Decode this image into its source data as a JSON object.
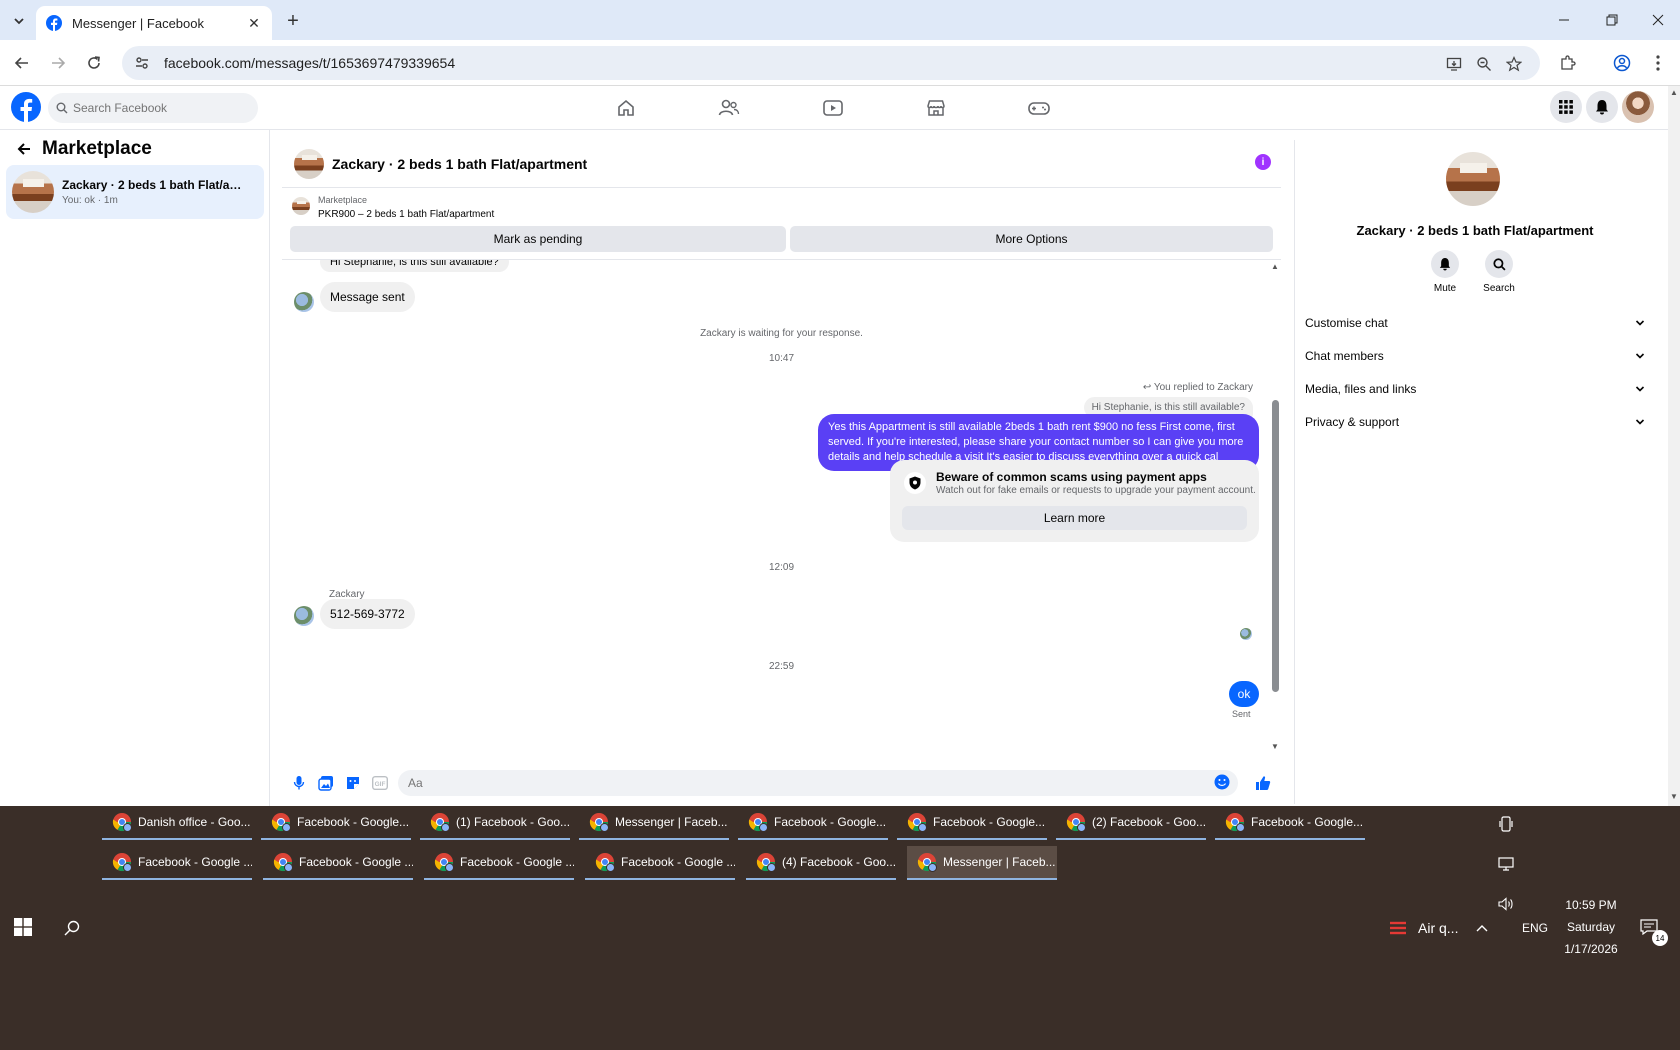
{
  "browser": {
    "tab_title": "Messenger | Facebook",
    "url": "facebook.com/messages/t/1653697479339654"
  },
  "facebook": {
    "search_placeholder": "Search Facebook"
  },
  "left": {
    "heading": "Marketplace",
    "conversation": {
      "title": "Zackary · 2 beds 1 bath Flat/apartment",
      "subtitle": "You: ok · 1m"
    }
  },
  "chat": {
    "title": "Zackary · 2 beds 1 bath Flat/apartment",
    "marketplace_label": "Marketplace",
    "listing": "PKR900 – 2 beds 1 bath Flat/apartment",
    "mark_pending": "Mark as pending",
    "more_options": "More Options",
    "messages": {
      "partial_top": "Hi Stephanie, is this still available?",
      "message_sent": "Message sent",
      "waiting": "Zackary is waiting for your response.",
      "time1": "10:47",
      "reply_note": "You replied to Zackary",
      "quoted": "Hi Stephanie, is this still available?",
      "reply_line1": "Yes this Appartment is still available 2beds 1 bath rent $900 no fess First come, first",
      "reply_line2": "served. If you're interested, please share your contact number so I can give you more",
      "reply_line3": "details and help schedule a visit It's easier to discuss everything over a quick cal",
      "scam_title": "Beware of common scams using payment apps",
      "scam_sub": "Watch out for fake emails or requests to upgrade your payment account.",
      "learn_more": "Learn more",
      "time2": "12:09",
      "sender": "Zackary",
      "phone": "512-569-3772",
      "time3": "22:59",
      "ok": "ok",
      "sent": "Sent"
    },
    "composer_placeholder": "Aa"
  },
  "right": {
    "title": "Zackary · 2 beds 1 bath Flat/apartment",
    "mute": "Mute",
    "search": "Search",
    "sections": [
      "Customise chat",
      "Chat members",
      "Media, files and links",
      "Privacy & support"
    ]
  },
  "taskbar": {
    "row1": [
      "Danish office - Goo...",
      "Facebook - Google...",
      "(1) Facebook - Goo...",
      "Messenger | Faceb...",
      "Facebook - Google...",
      "Facebook - Google...",
      "(2) Facebook - Goo...",
      "Facebook - Google..."
    ],
    "row2": [
      "Facebook - Google ...",
      "Facebook - Google ...",
      "Facebook - Google ...",
      "Facebook - Google ...",
      "(4) Facebook - Goo...",
      "Messenger | Faceb..."
    ],
    "weather": "Air q...",
    "lang": "ENG",
    "time": "10:59 PM",
    "day": "Saturday",
    "date": "1/17/2026",
    "notifications": "14"
  }
}
